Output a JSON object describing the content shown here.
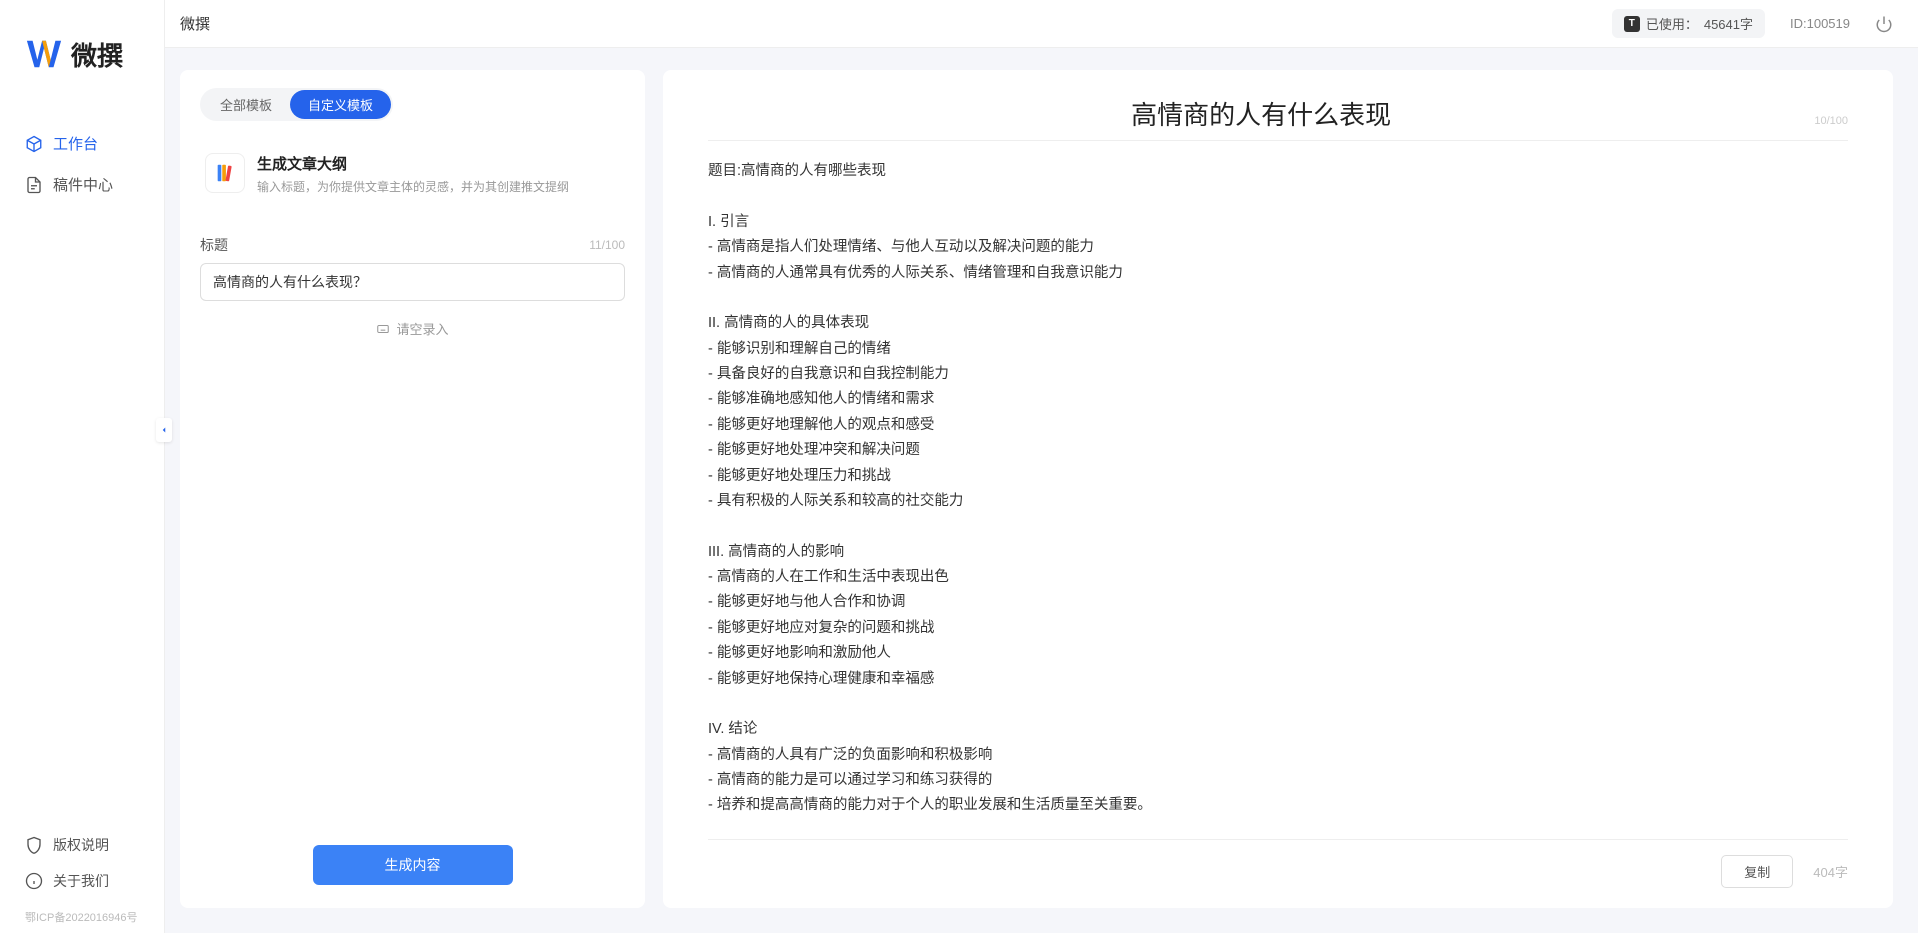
{
  "app": {
    "name": "微撰",
    "logo_text": "微撰"
  },
  "sidebar": {
    "items": [
      {
        "label": "工作台",
        "active": true
      },
      {
        "label": "稿件中心",
        "active": false
      }
    ],
    "footer_items": [
      {
        "label": "版权说明"
      },
      {
        "label": "关于我们"
      }
    ],
    "icp": "鄂ICP备2022016946号"
  },
  "topbar": {
    "title": "微撰",
    "usage_label": "已使用：",
    "usage_value": "45641字",
    "id_label": "ID:100519"
  },
  "left_panel": {
    "tabs": [
      {
        "label": "全部模板",
        "active": false
      },
      {
        "label": "自定义模板",
        "active": true
      }
    ],
    "template": {
      "title": "生成文章大纲",
      "desc": "输入标题，为你提供文章主体的灵感，并为其创建推文提纲"
    },
    "form": {
      "title_label": "标题",
      "title_counter": "11/100",
      "title_value": "高情商的人有什么表现？",
      "voice_label": "请空录入"
    },
    "generate_label": "生成内容"
  },
  "right_panel": {
    "title": "高情商的人有什么表现",
    "title_counter": "10/100",
    "body": "题目:高情商的人有哪些表现\n\nI. 引言\n- 高情商是指人们处理情绪、与他人互动以及解决问题的能力\n- 高情商的人通常具有优秀的人际关系、情绪管理和自我意识能力\n\nII. 高情商的人的具体表现\n- 能够识别和理解自己的情绪\n- 具备良好的自我意识和自我控制能力\n- 能够准确地感知他人的情绪和需求\n- 能够更好地理解他人的观点和感受\n- 能够更好地处理冲突和解决问题\n- 能够更好地处理压力和挑战\n- 具有积极的人际关系和较高的社交能力\n\nIII. 高情商的人的影响\n- 高情商的人在工作和生活中表现出色\n- 能够更好地与他人合作和协调\n- 能够更好地应对复杂的问题和挑战\n- 能够更好地影响和激励他人\n- 能够更好地保持心理健康和幸福感\n\nIV. 结论\n- 高情商的人具有广泛的负面影响和积极影响\n- 高情商的能力是可以通过学习和练习获得的\n- 培养和提高高情商的能力对于个人的职业发展和生活质量至关重要。",
    "copy_label": "复制",
    "word_count": "404字"
  }
}
